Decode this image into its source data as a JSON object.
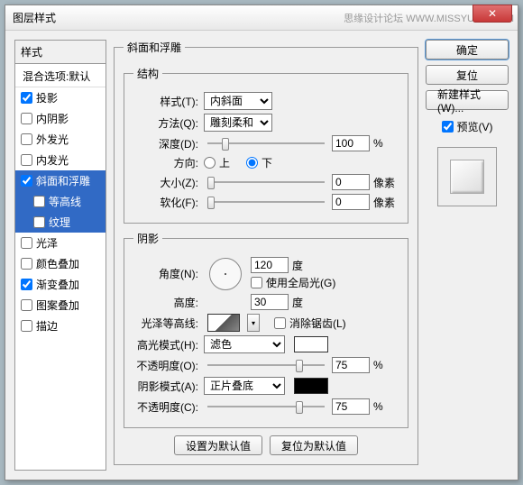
{
  "title": "图层样式",
  "watermark": "思缘设计论坛 WWW.MISSYUAN.COM",
  "left": {
    "header": "样式",
    "default": "混合选项:默认",
    "items": [
      {
        "label": "投影",
        "checked": true
      },
      {
        "label": "内阴影",
        "checked": false
      },
      {
        "label": "外发光",
        "checked": false
      },
      {
        "label": "内发光",
        "checked": false
      },
      {
        "label": "斜面和浮雕",
        "checked": true,
        "selected": true
      },
      {
        "label": "等高线",
        "checked": false,
        "sub": true,
        "selected": true
      },
      {
        "label": "纹理",
        "checked": false,
        "sub": true,
        "selected": true
      },
      {
        "label": "光泽",
        "checked": false
      },
      {
        "label": "颜色叠加",
        "checked": false
      },
      {
        "label": "渐变叠加",
        "checked": true
      },
      {
        "label": "图案叠加",
        "checked": false
      },
      {
        "label": "描边",
        "checked": false
      }
    ]
  },
  "main": {
    "panel_title": "斜面和浮雕",
    "structure": {
      "legend": "结构",
      "style_label": "样式(T):",
      "style_value": "内斜面",
      "technique_label": "方法(Q):",
      "technique_value": "雕刻柔和",
      "depth_label": "深度(D):",
      "depth_value": "100",
      "depth_unit": "%",
      "direction_label": "方向:",
      "up": "上",
      "down": "下",
      "size_label": "大小(Z):",
      "size_value": "0",
      "size_unit": "像素",
      "soften_label": "软化(F):",
      "soften_value": "0",
      "soften_unit": "像素"
    },
    "shading": {
      "legend": "阴影",
      "angle_label": "角度(N):",
      "angle_value": "120",
      "angle_unit": "度",
      "global_light": "使用全局光(G)",
      "altitude_label": "高度:",
      "altitude_value": "30",
      "altitude_unit": "度",
      "gloss_label": "光泽等高线:",
      "antialias": "消除锯齿(L)",
      "highlight_mode_label": "高光模式(H):",
      "highlight_mode": "滤色",
      "highlight_color": "#ffffff",
      "highlight_opacity_label": "不透明度(O):",
      "highlight_opacity": "75",
      "shadow_mode_label": "阴影模式(A):",
      "shadow_mode": "正片叠底",
      "shadow_color": "#000000",
      "shadow_opacity_label": "不透明度(C):",
      "shadow_opacity": "75",
      "opacity_unit": "%"
    },
    "buttons": {
      "default": "设置为默认值",
      "reset": "复位为默认值"
    }
  },
  "right": {
    "ok": "确定",
    "cancel": "复位",
    "new_style": "新建样式(W)...",
    "preview_label": "预览(V)"
  }
}
